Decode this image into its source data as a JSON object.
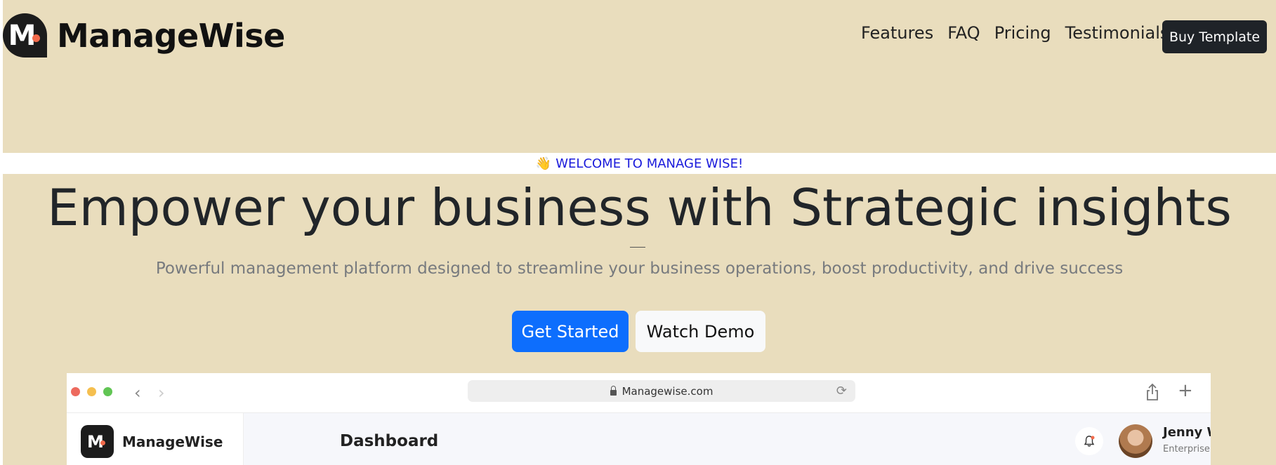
{
  "header": {
    "logo_letter": "M",
    "brand": "ManageWise",
    "nav": [
      "Features",
      "FAQ",
      "Pricing",
      "Testimonials"
    ],
    "buy_button": "Buy Template"
  },
  "hero": {
    "welcome_icon": "👋",
    "welcome": "WELCOME TO MANAGE WISE!",
    "headline": "Empower your business with Strategic insights",
    "subtitle": "Powerful management platform designed to streamline your business operations, boost productivity, and drive success",
    "primary_cta": "Get Started",
    "secondary_cta": "Watch Demo"
  },
  "browser": {
    "url": "Managewise.com",
    "traffic_colors": [
      "#ed6a5e",
      "#f5bf4f",
      "#61c554"
    ],
    "app": {
      "logo_letter": "M",
      "brand": "ManageWise",
      "page_title": "Dashboard",
      "user_name": "Jenny Wilson",
      "user_plan": "Enterprise plan"
    }
  },
  "colors": {
    "background": "#e9ddbd",
    "primary": "#0d6efd",
    "dark": "#1f2328",
    "welcome_text": "#1a1adb"
  }
}
